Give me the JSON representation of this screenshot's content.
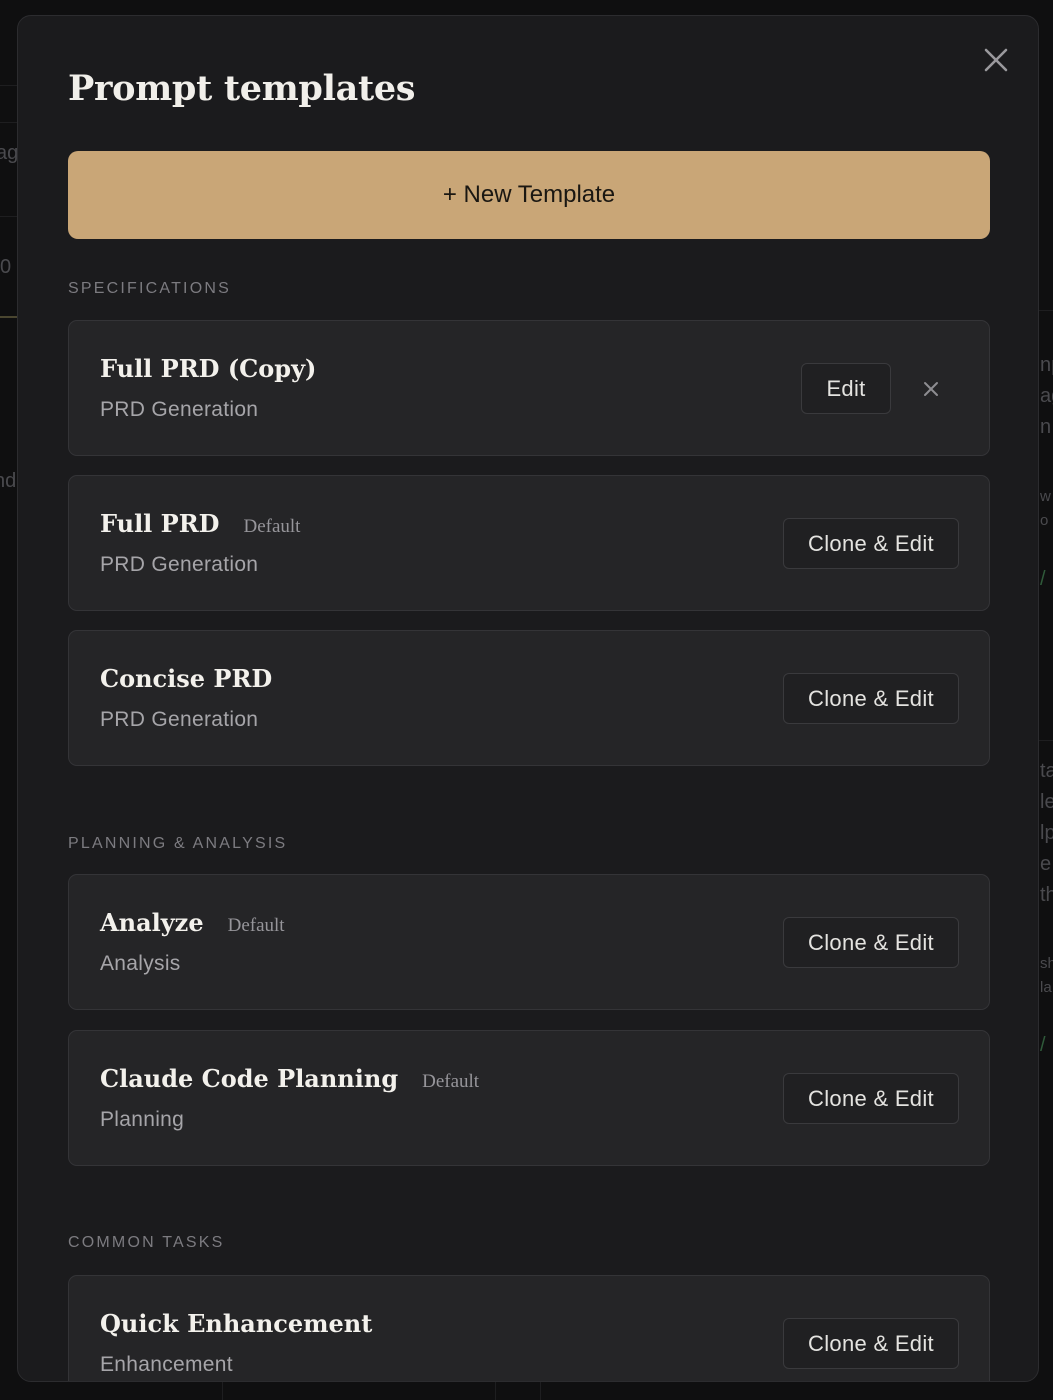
{
  "modal": {
    "title": "Prompt templates",
    "new_button_label": "+ New Template"
  },
  "background_fragments": {
    "left": [
      "ag",
      "0",
      "nd"
    ],
    "right": [
      "np",
      "ag",
      "n",
      "w",
      "o",
      "ta",
      "le",
      "lp",
      "e",
      "th",
      "sh",
      "la"
    ]
  },
  "sections": [
    {
      "label": "SPECIFICATIONS",
      "cards": [
        {
          "name": "Full PRD (Copy)",
          "badge": "",
          "category": "PRD Generation",
          "action": "Edit"
        },
        {
          "name": "Full PRD",
          "badge": "Default",
          "category": "PRD Generation",
          "action": "Clone & Edit"
        },
        {
          "name": "Concise PRD",
          "badge": "",
          "category": "PRD Generation",
          "action": "Clone & Edit"
        }
      ]
    },
    {
      "label": "PLANNING & ANALYSIS",
      "cards": [
        {
          "name": "Analyze",
          "badge": "Default",
          "category": "Analysis",
          "action": "Clone & Edit"
        },
        {
          "name": "Claude Code Planning",
          "badge": "Default",
          "category": "Planning",
          "action": "Clone & Edit"
        }
      ]
    },
    {
      "label": "COMMON TASKS",
      "cards": [
        {
          "name": "Quick Enhancement",
          "badge": "",
          "category": "Enhancement",
          "action": "Clone & Edit"
        }
      ]
    }
  ],
  "icons": {
    "close": "close-icon",
    "delete": "close-icon"
  },
  "colors": {
    "accent": "#c9a677",
    "modal_bg": "#1b1b1d",
    "card_bg": "#252527"
  }
}
